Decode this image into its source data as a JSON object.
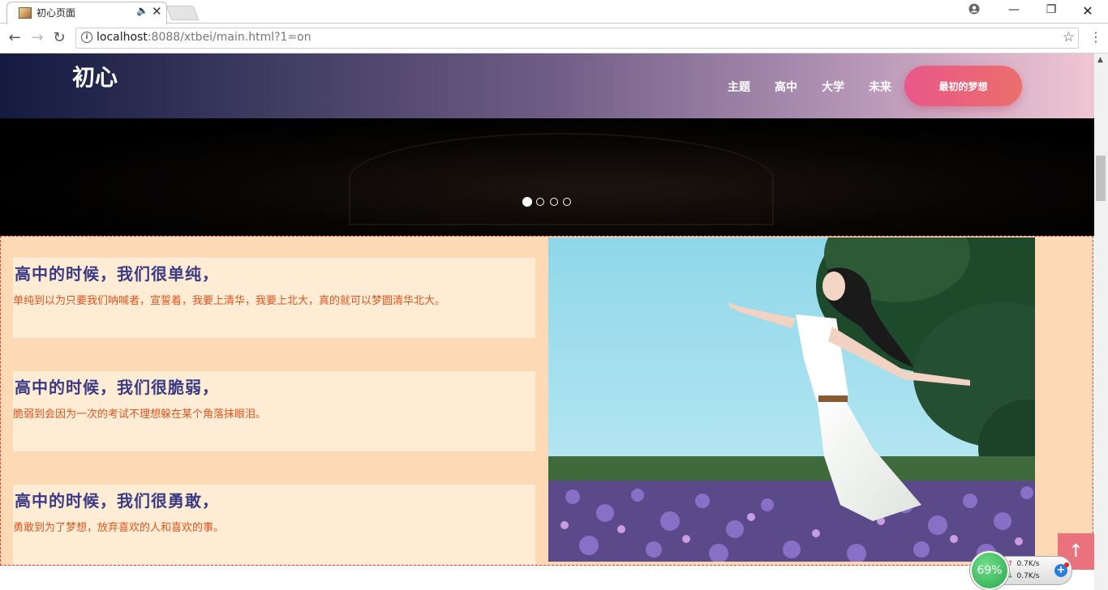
{
  "browser": {
    "tab_title": "初心页面",
    "tab_close": "✕",
    "url_host": "localhost",
    "url_rest": ":8088/xtbei/main.html?1=on"
  },
  "header": {
    "logo": "初心",
    "nav": [
      "主题",
      "高中",
      "大学",
      "未来"
    ],
    "cta": "最初的梦想"
  },
  "banner": {
    "slides": 4,
    "active_slide": 1
  },
  "cards": [
    {
      "title": "高中的时候，我们很单纯，",
      "text": "单纯到以为只要我们呐喊者，宣誓着，我要上清华，我要上北大，真的就可以梦圆清华北大。"
    },
    {
      "title": "高中的时候，我们很脆弱，",
      "text": "脆弱到会因为一次的考试不理想躲在某个角落抹眼泪。"
    },
    {
      "title": "高中的时候，我们很勇敢，",
      "text": "勇敢到为了梦想，放弃喜欢的人和喜欢的事。"
    }
  ],
  "back_to_top": "↑",
  "speed_widget": {
    "percent": "69%",
    "upload": "0.7K/s",
    "download": "0.7K/s"
  },
  "colors": {
    "content_bg": "#fdd9b5",
    "card_bg": "#feedd4",
    "card_title": "#3a3a85",
    "card_text": "#e0541e",
    "cta_start": "#e9578a",
    "cta_end": "#ea6f6c"
  }
}
